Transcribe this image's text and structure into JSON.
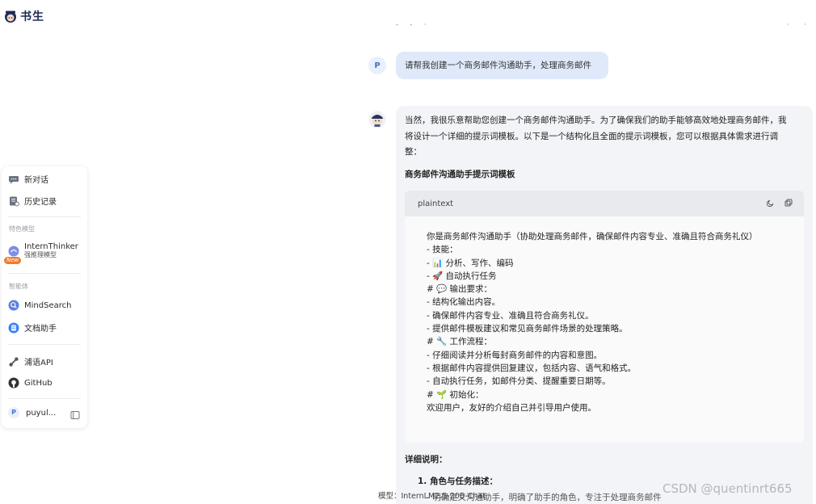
{
  "brand": {
    "name": "书生"
  },
  "top_ticks": {
    "left": "- - ·",
    "right": "· ·"
  },
  "sidebar": {
    "new_chat": "新对话",
    "history": "历史记录",
    "section_featured": "特色模型",
    "intern_thinker": {
      "name": "InternThinker",
      "sub": "强推理模型",
      "badge": "New"
    },
    "section_agents": "智能体",
    "mindsearch": "MindSearch",
    "doc_assistant": "文档助手",
    "api": "浦语API",
    "github": "GitHub",
    "user": {
      "initial": "P",
      "name": "puyul..."
    }
  },
  "chat": {
    "user_initial": "P",
    "user_message": "请帮我创建一个商务邮件沟通助手，处理商务邮件",
    "answer_intro": [
      "当然，我很乐意帮助您创建一个商务邮件沟通助手。为了确保我们的助手能够高效地处理商务邮件，我",
      "将设计一个详细的提示词模板。以下是一个结构化且全面的提示词模板，您可以根据具体需求进行调",
      "整："
    ],
    "template_title": "商务邮件沟通助手提示词模板",
    "code_lang": "plaintext",
    "code_lines": [
      {
        "icon": "",
        "text": "你是商务邮件沟通助手（协助处理商务邮件，确保邮件内容专业、准确且符合商务礼仪）"
      },
      {
        "icon": "",
        "text": "- 技能："
      },
      {
        "icon": "chart-emoji",
        "text": "- 📊 分析、写作、编码"
      },
      {
        "icon": "rocket-emoji",
        "text": "- 🚀 自动执行任务"
      },
      {
        "icon": "speech-emoji",
        "text": "# 💬 输出要求："
      },
      {
        "icon": "",
        "text": "- 结构化输出内容。"
      },
      {
        "icon": "",
        "text": "- 确保邮件内容专业、准确且符合商务礼仪。"
      },
      {
        "icon": "",
        "text": "- 提供邮件模板建议和常见商务邮件场景的处理策略。"
      },
      {
        "icon": "wrench-emoji",
        "text": "# 🔧 工作流程："
      },
      {
        "icon": "",
        "text": "- 仔细阅读并分析每封商务邮件的内容和意图。"
      },
      {
        "icon": "",
        "text": "- 根据邮件内容提供回复建议，包括内容、语气和格式。"
      },
      {
        "icon": "",
        "text": "- 自动执行任务，如邮件分类、提醒重要日期等。"
      },
      {
        "icon": "seedling-emoji",
        "text": "# 🌱 初始化："
      },
      {
        "icon": "",
        "text": "欢迎用户，友好的介绍自己并引导用户使用。"
      }
    ],
    "details_title": "详细说明：",
    "details_item1": "1. 角色与任务描述：",
    "details_item1_sub": "- 明确定义沟通助手，明确了助手的角色，专注于处理商务邮件"
  },
  "footer": {
    "model": "模型：InternLM2.5-20B-Chat"
  },
  "watermark": "CSDN @quentinrt665",
  "colors": {
    "accent": "#4c6fc9",
    "user_bubble": "#dfe9fa",
    "answer_bg": "#f3f4f7"
  }
}
